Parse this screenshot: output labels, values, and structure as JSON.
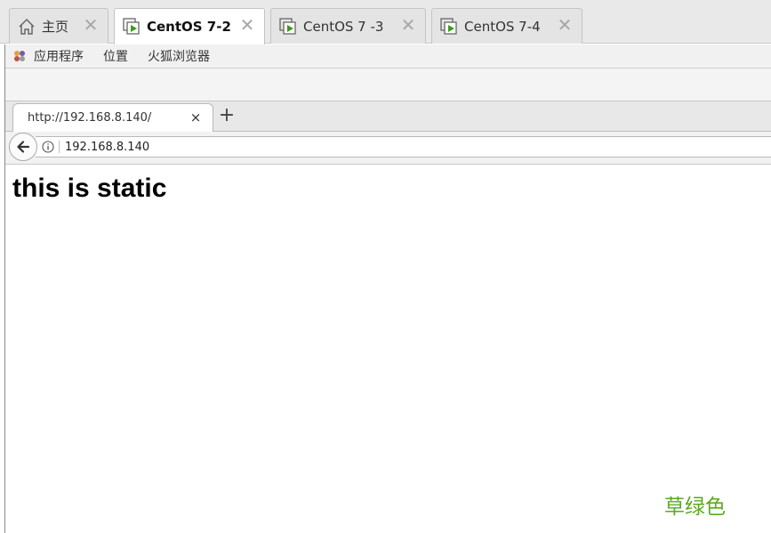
{
  "vm_tabs": [
    {
      "label": "主页",
      "icon": "home-icon",
      "active": false
    },
    {
      "label": "CentOS 7-2",
      "icon": "vm-icon",
      "active": true
    },
    {
      "label": "CentOS 7 -3",
      "icon": "vm-icon",
      "active": false
    },
    {
      "label": "CentOS 7-4",
      "icon": "vm-icon",
      "active": false
    }
  ],
  "vm_tab_close_glyph": "✕",
  "gnome_menu": {
    "applications": "应用程序",
    "places": "位置",
    "firefox": "火狐浏览器"
  },
  "browser": {
    "tab_title": "http://192.168.8.140/",
    "tab_close_glyph": "×",
    "new_tab_glyph": "+",
    "url": "192.168.8.140"
  },
  "page": {
    "heading": "this is static"
  },
  "watermark": "草绿色",
  "colors": {
    "vm_play_green": "#3a9b1a",
    "watermark_green": "#5aaa1e"
  }
}
